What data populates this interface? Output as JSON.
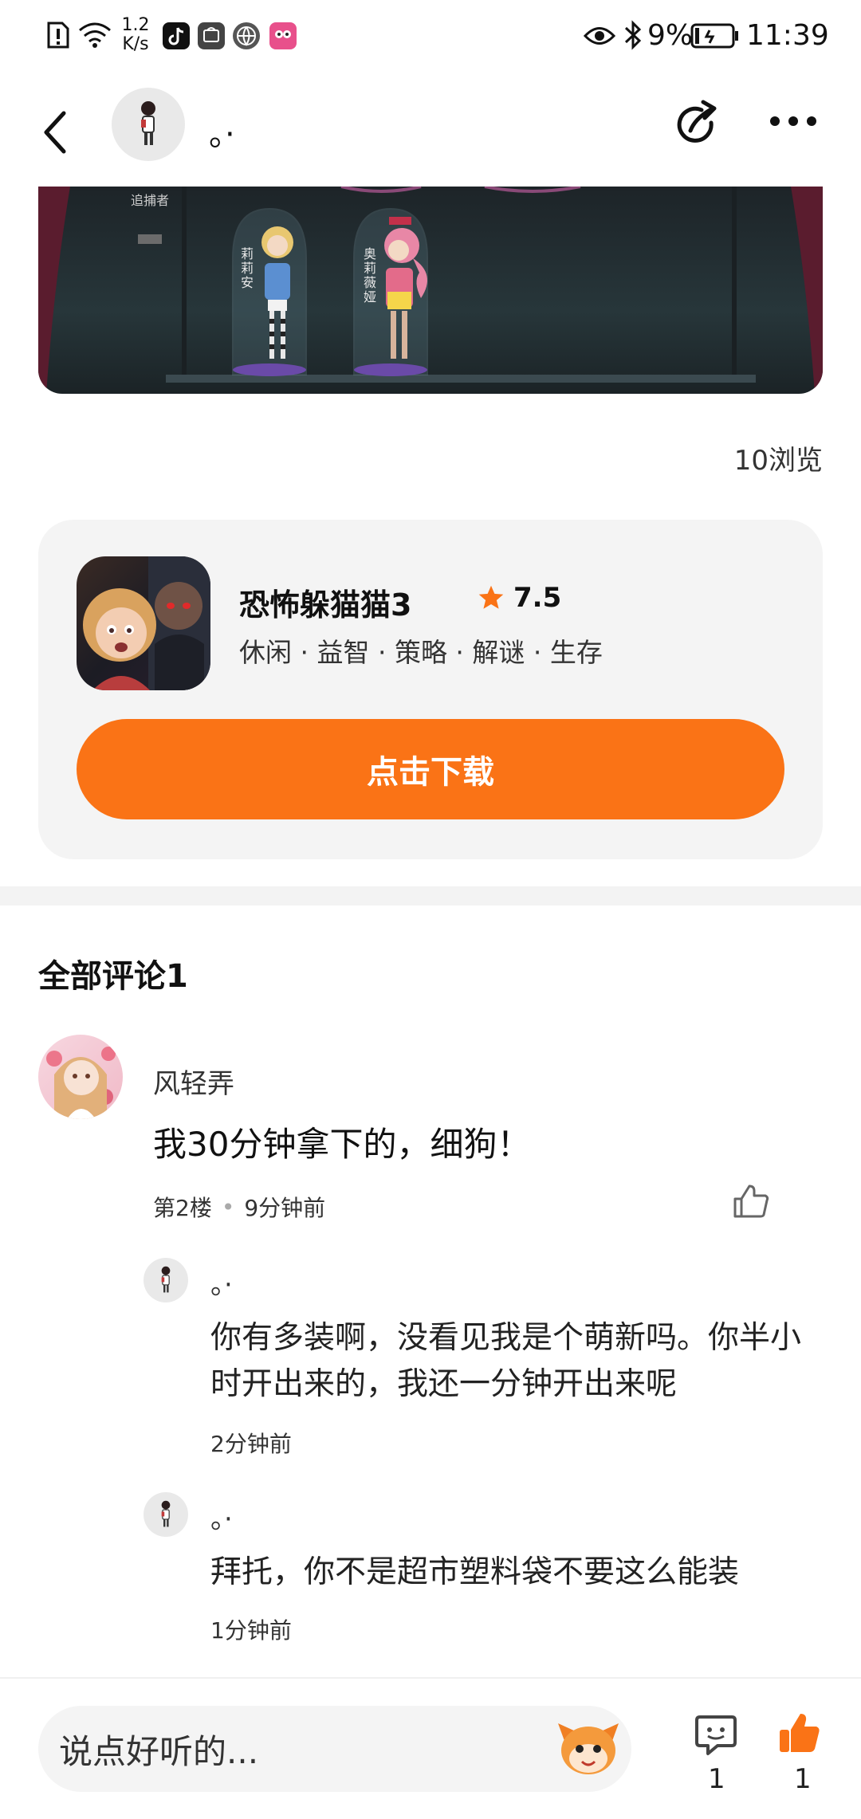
{
  "status_bar": {
    "net_speed_value": "1.2",
    "net_speed_unit": "K/s",
    "battery": "9%",
    "time": "11:39",
    "icons": [
      "alert-icon",
      "wifi-icon",
      "tiktok-icon",
      "huawei-icon",
      "browser-icon",
      "app-icon",
      "eye-icon",
      "bluetooth-icon",
      "battery-icon"
    ]
  },
  "nav": {
    "author_name": "。·",
    "icons": [
      "back-icon",
      "share-icon",
      "more-icon"
    ]
  },
  "hero": {
    "sign_text": "追捕者",
    "char1_label": "莉莉安",
    "char2_label": "奥莉薇娅"
  },
  "post": {
    "views": "10浏览"
  },
  "game": {
    "title": "恐怖躲猫猫3",
    "rating": "7.5",
    "tags": "休闲 · 益智 · 策略 · 解谜 · 生存",
    "download_label": "点击下载"
  },
  "comments": {
    "section_title": "全部评论1",
    "main": {
      "username": "风轻弄",
      "text": "我30分钟拿下的，细狗！",
      "floor": "第2楼",
      "time": "9分钟前"
    },
    "replies": [
      {
        "username": "。·",
        "text": "你有多装啊，没看见我是个萌新吗。你半小时开出来的，我还一分钟开出来呢",
        "time": "2分钟前"
      },
      {
        "username": "。·",
        "text": "拜托，你不是超市塑料袋不要这么能装",
        "time": "1分钟前"
      }
    ]
  },
  "bottom_bar": {
    "placeholder": "说点好听的...",
    "comment_count": "1",
    "like_count": "1"
  },
  "colors": {
    "accent": "#fa7316",
    "card_bg": "#f4f4f4",
    "divider": "#f3f3f3"
  }
}
